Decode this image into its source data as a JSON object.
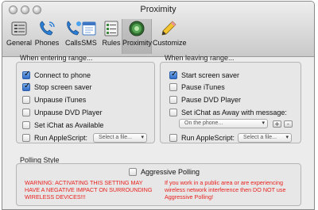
{
  "window": {
    "title": "Proximity"
  },
  "toolbar": {
    "items": [
      {
        "label": "General",
        "icon": "general-icon"
      },
      {
        "label": "Phones",
        "icon": "phone-icon"
      },
      {
        "label": "Calls",
        "icon": "calls-icon"
      },
      {
        "label": "SMS",
        "icon": "sms-icon"
      },
      {
        "label": "Rules",
        "icon": "rules-icon"
      },
      {
        "label": "Proximity",
        "icon": "proximity-icon",
        "selected": true
      },
      {
        "label": "Customize",
        "icon": "pencil-icon"
      }
    ]
  },
  "entering": {
    "title": "When entering range...",
    "options": [
      {
        "label": "Connect to phone",
        "checked": true
      },
      {
        "label": "Stop screen saver",
        "checked": true
      },
      {
        "label": "Unpause iTunes",
        "checked": false
      },
      {
        "label": "Unpause DVD Player",
        "checked": false
      },
      {
        "label": "Set iChat as Available",
        "checked": false
      }
    ],
    "applescript": {
      "label": "Run AppleScript:",
      "checked": false,
      "file_placeholder": "Select a file..."
    }
  },
  "leaving": {
    "title": "When leaving range...",
    "options": [
      {
        "label": "Start screen saver",
        "checked": true
      },
      {
        "label": "Pause iTunes",
        "checked": false
      },
      {
        "label": "Pause DVD Player",
        "checked": false
      },
      {
        "label": "Set iChat as Away with message:",
        "checked": false
      }
    ],
    "message_select": "On the phone...",
    "add_label": "+",
    "remove_label": "-",
    "applescript": {
      "label": "Run AppleScript:",
      "checked": false,
      "file_placeholder": "Select a file..."
    }
  },
  "polling": {
    "title": "Polling Style",
    "aggressive_label": "Aggressive Polling",
    "aggressive_checked": false,
    "warning_left": "WARNING: ACTIVATING THIS SETTING MAY HAVE A NEGATIVE IMPACT ON SURROUNDING WIRELESS DEVICES!!!",
    "warning_right": "If you work in a public area or are experiencing wireless network interference then DO NOT use Aggressive Polling!"
  },
  "colors": {
    "warning": "#e8201d",
    "checkbox_checked": "#2f6cc9"
  }
}
